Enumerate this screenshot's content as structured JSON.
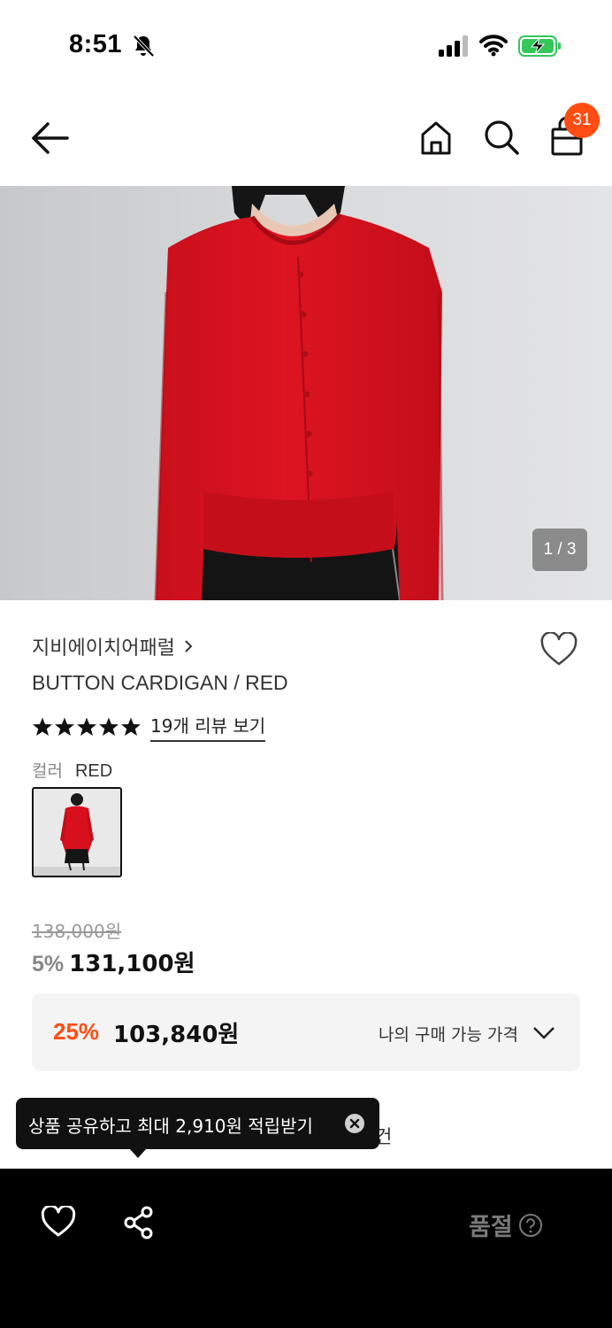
{
  "status_bar": {
    "time": "8:51",
    "icons": [
      "bell-off-icon",
      "signal-icon",
      "wifi-icon",
      "battery-charging-icon"
    ]
  },
  "nav": {
    "icons": [
      "back-arrow-icon",
      "home-icon",
      "search-icon",
      "shopping-bag-icon"
    ],
    "cart_count": "31"
  },
  "gallery": {
    "counter": "1 / 3",
    "colors": {
      "garment": "#d8101e",
      "background": "#dadbdd"
    }
  },
  "product": {
    "brand": "지비에이치어패럴",
    "name": "BUTTON CARDIGAN / RED",
    "rating_stars": 5,
    "review_link": "19개 리뷰 보기",
    "color_label": "컬러",
    "color_value": "RED"
  },
  "price": {
    "original": "138,000원",
    "discount_rate": "5%",
    "sale": "131,100원"
  },
  "benefit": {
    "rate": "25%",
    "price": "103,840원",
    "label": "나의 구매 가능 가격"
  },
  "partial_text": "건",
  "tooltip": {
    "text": "상품 공유하고 최대 2,910원 적립받기"
  },
  "bottom_bar": {
    "soldout_label": "품절"
  },
  "colors": {
    "accent": "#ff4d14",
    "bottom_bar": "#000000",
    "soldout_text": "#7a7a7a"
  }
}
